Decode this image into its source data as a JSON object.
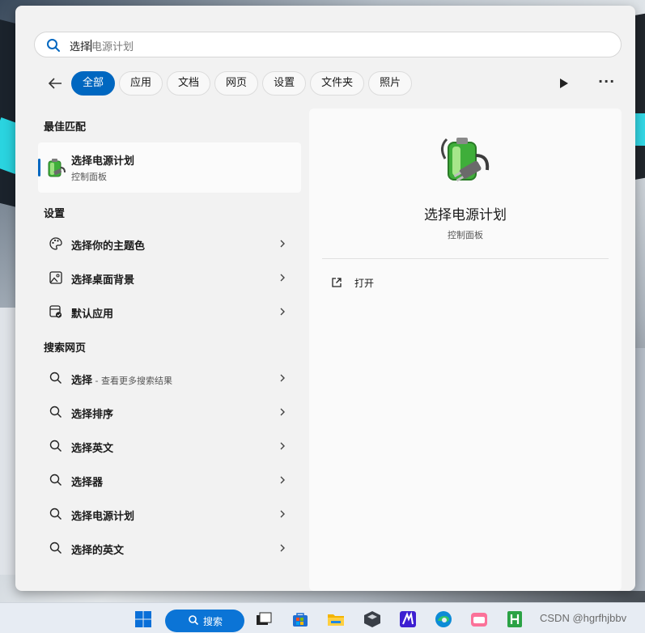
{
  "search": {
    "typed": "选择",
    "suggestion_rest": "电源计划"
  },
  "filters": [
    "全部",
    "应用",
    "文档",
    "网页",
    "设置",
    "文件夹",
    "照片"
  ],
  "best_match": {
    "section": "最佳匹配",
    "title": "选择电源计划",
    "subtitle": "控制面板"
  },
  "settings": {
    "section": "设置",
    "items": [
      {
        "label": "选择你的主题色",
        "icon": "palette-icon"
      },
      {
        "label": "选择桌面背景",
        "icon": "picture-icon"
      },
      {
        "label": "默认应用",
        "icon": "default-apps-icon"
      }
    ]
  },
  "web": {
    "section": "搜索网页",
    "first": {
      "label": "选择",
      "hint": " - 查看更多搜索结果"
    },
    "items": [
      "选择排序",
      "选择英文",
      "选择器",
      "选择电源计划",
      "选择的英文"
    ]
  },
  "preview": {
    "title": "选择电源计划",
    "subtitle": "控制面板",
    "open_label": "打开"
  },
  "taskbar": {
    "search_label": "搜索",
    "watermark": "CSDN @hgrfhjbbv"
  },
  "colors": {
    "accent": "#0067c0",
    "panel": "#f2f2f2"
  }
}
